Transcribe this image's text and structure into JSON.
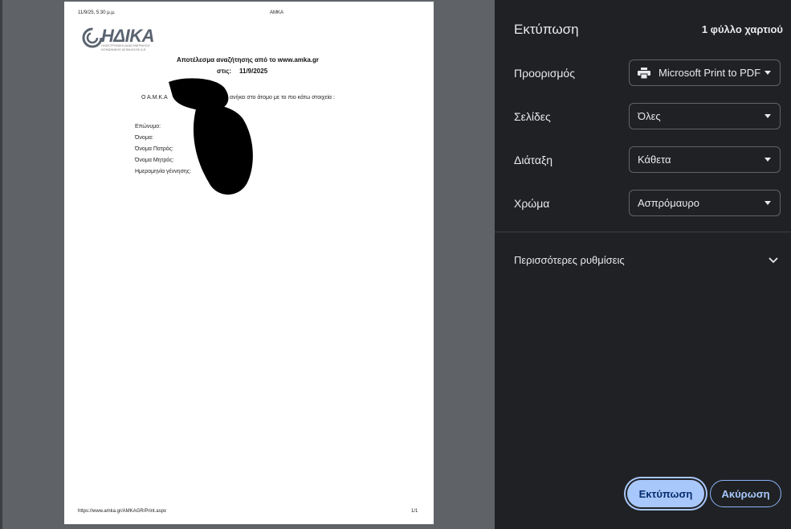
{
  "preview": {
    "header_datetime": "11/9/25, 5:30 μ.μ.",
    "header_title": "AMKA",
    "logo": {
      "brand": "ΗΔΙΚΑ",
      "tagline": "ΗΛΕΚΤΡΟΝΙΚΗ ΔΙΑΚΥΒΕΡΝΗΣΗ ΚΟΙΝΩΝΙΚΗΣ ΑΣΦΑΛΙΣΗΣ Α.Ε."
    },
    "result_heading": "Αποτέλεσμα αναζήτησης από το www.amka.gr",
    "date_label": "στις:",
    "date_value": "11/9/2025",
    "statement_start": "Ο Α.Μ.Κ.Α",
    "statement_end": "ανήκει στο άτομο με το πιο κάτω στοιχεία :",
    "fields": [
      "Επώνυμο:",
      "Όνομα:",
      "Όνομα Πατρός:",
      "Όνομα Μητρός:",
      "Ημερομηνία γέννησης:"
    ],
    "footer_url": "https://www.amka.gr/AMKAGR/Print.aspx",
    "footer_page": "1/1"
  },
  "settings": {
    "title": "Εκτύπωση",
    "sheet_count": "1 φύλλο χαρτιού",
    "destination": {
      "label": "Προορισμός",
      "value": "Microsoft Print to PDF",
      "icon": "printer-icon"
    },
    "pages": {
      "label": "Σελίδες",
      "value": "Όλες"
    },
    "layout": {
      "label": "Διάταξη",
      "value": "Κάθετα"
    },
    "color": {
      "label": "Χρώμα",
      "value": "Ασπρόμαυρο"
    },
    "more_settings": "Περισσότερες ρυθμίσεις",
    "print_button": "Εκτύπωση",
    "cancel_button": "Ακύρωση"
  },
  "colors": {
    "panel_bg": "#202124",
    "preview_bg": "#5f6368",
    "accent": "#a8c7fa"
  }
}
